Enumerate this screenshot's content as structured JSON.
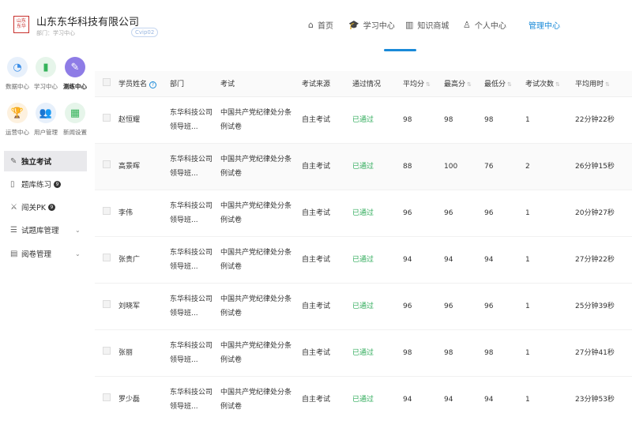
{
  "header": {
    "logo_text": "山东\n东华",
    "company_name": "山东东华科技有限公司",
    "subline": "部门：学习中心",
    "badge": "Cvip02"
  },
  "nav": [
    {
      "label": "首页",
      "icon": "home-icon",
      "glyph": "⌂"
    },
    {
      "label": "学习中心",
      "icon": "graduation-cap-icon",
      "glyph": "🎓"
    },
    {
      "label": "知识商城",
      "icon": "books-icon",
      "glyph": "▥"
    },
    {
      "label": "个人中心",
      "icon": "person-icon",
      "glyph": "♙"
    },
    {
      "label": "管理中心",
      "icon": "",
      "glyph": ""
    }
  ],
  "modules": [
    {
      "label": "数据中心",
      "icon": "pie-chart-icon",
      "glyph": "◔",
      "bg": "#e7f0fb",
      "fg": "#3b8ee8"
    },
    {
      "label": "学习中心",
      "icon": "book-icon",
      "glyph": "▮",
      "bg": "#e6f5ea",
      "fg": "#36b35b"
    },
    {
      "label": "测练中心",
      "icon": "pencil-icon",
      "glyph": "✎",
      "bg": "#8e7ce6",
      "fg": "#ffffff"
    },
    {
      "label": "运营中心",
      "icon": "trophy-icon",
      "glyph": "🏆",
      "bg": "#fdf1df",
      "fg": "#f0a53a"
    },
    {
      "label": "用户管理",
      "icon": "users-icon",
      "glyph": "👥",
      "bg": "#e7f0fb",
      "fg": "#3b8ee8"
    },
    {
      "label": "新闻设置",
      "icon": "grid-icon",
      "glyph": "▦",
      "bg": "#e6f5ea",
      "fg": "#36b35b"
    }
  ],
  "menu": [
    {
      "label": "独立考试",
      "icon": "exam-icon",
      "glyph": "✎",
      "badge": "",
      "chevron": ""
    },
    {
      "label": "题库练习",
      "icon": "book-open-icon",
      "glyph": "▯",
      "badge": "9",
      "chevron": ""
    },
    {
      "label": "闯关PK",
      "icon": "swords-icon",
      "glyph": "⚔",
      "badge": "9",
      "chevron": ""
    },
    {
      "label": "试题库管理",
      "icon": "list-icon",
      "glyph": "☰",
      "badge": "",
      "chevron": "⌄"
    },
    {
      "label": "阅卷管理",
      "icon": "review-icon",
      "glyph": "▤",
      "badge": "",
      "chevron": "⌄"
    }
  ],
  "table": {
    "headers": [
      "学员姓名",
      "部门",
      "考试",
      "考试来源",
      "通过情况",
      "平均分",
      "最高分",
      "最低分",
      "考试次数",
      "平均用时"
    ],
    "rows": [
      {
        "name": "赵恒耀",
        "dept": "东华科技公司领导班...",
        "exam": "中国共产党纪律处分条例试卷",
        "source": "自主考试",
        "status": "已通过",
        "avg": "98",
        "max": "98",
        "min": "98",
        "count": "1",
        "time": "22分钟22秒"
      },
      {
        "name": "高景晖",
        "dept": "东华科技公司领导班...",
        "exam": "中国共产党纪律处分条例试卷",
        "source": "自主考试",
        "status": "已通过",
        "avg": "88",
        "max": "100",
        "min": "76",
        "count": "2",
        "time": "26分钟15秒"
      },
      {
        "name": "李伟",
        "dept": "东华科技公司领导班...",
        "exam": "中国共产党纪律处分条例试卷",
        "source": "自主考试",
        "status": "已通过",
        "avg": "96",
        "max": "96",
        "min": "96",
        "count": "1",
        "time": "20分钟27秒"
      },
      {
        "name": "张贵广",
        "dept": "东华科技公司领导班...",
        "exam": "中国共产党纪律处分条例试卷",
        "source": "自主考试",
        "status": "已通过",
        "avg": "94",
        "max": "94",
        "min": "94",
        "count": "1",
        "time": "27分钟22秒"
      },
      {
        "name": "刘晓军",
        "dept": "东华科技公司领导班...",
        "exam": "中国共产党纪律处分条例试卷",
        "source": "自主考试",
        "status": "已通过",
        "avg": "96",
        "max": "96",
        "min": "96",
        "count": "1",
        "time": "25分钟39秒"
      },
      {
        "name": "张丽",
        "dept": "东华科技公司领导班...",
        "exam": "中国共产党纪律处分条例试卷",
        "source": "自主考试",
        "status": "已通过",
        "avg": "98",
        "max": "98",
        "min": "98",
        "count": "1",
        "time": "27分钟41秒"
      },
      {
        "name": "罗少磊",
        "dept": "东华科技公司领导班...",
        "exam": "中国共产党纪律处分条例试卷",
        "source": "自主考试",
        "status": "已通过",
        "avg": "94",
        "max": "94",
        "min": "94",
        "count": "1",
        "time": "23分钟53秒"
      }
    ]
  },
  "colors": {
    "accent": "#1a8ad8",
    "passed": "#2fab5a"
  }
}
